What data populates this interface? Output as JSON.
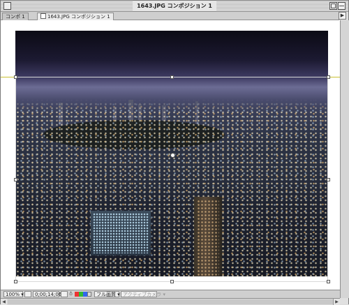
{
  "window": {
    "title": "1643.JPG コンポジション 1"
  },
  "tabs": [
    {
      "label": "コンポ 1",
      "active": false
    },
    {
      "label": "1643.JPG コンポジション 1",
      "active": true
    }
  ],
  "side_buttons": [
    "▶",
    "◘",
    "▲"
  ],
  "statusbar": {
    "zoom": "100%",
    "timecode": "0;00;14;06",
    "resolution": "フル画質",
    "view": "アクティブカメラ"
  },
  "colors": {
    "guide": "#c9c032",
    "window_bg": "#dedede",
    "canvas_bg": "#ffffff"
  },
  "icons": [
    "close-box",
    "zoom-box",
    "collapse-box",
    "camera-icon",
    "grid-icon",
    "color-channel-icon"
  ]
}
